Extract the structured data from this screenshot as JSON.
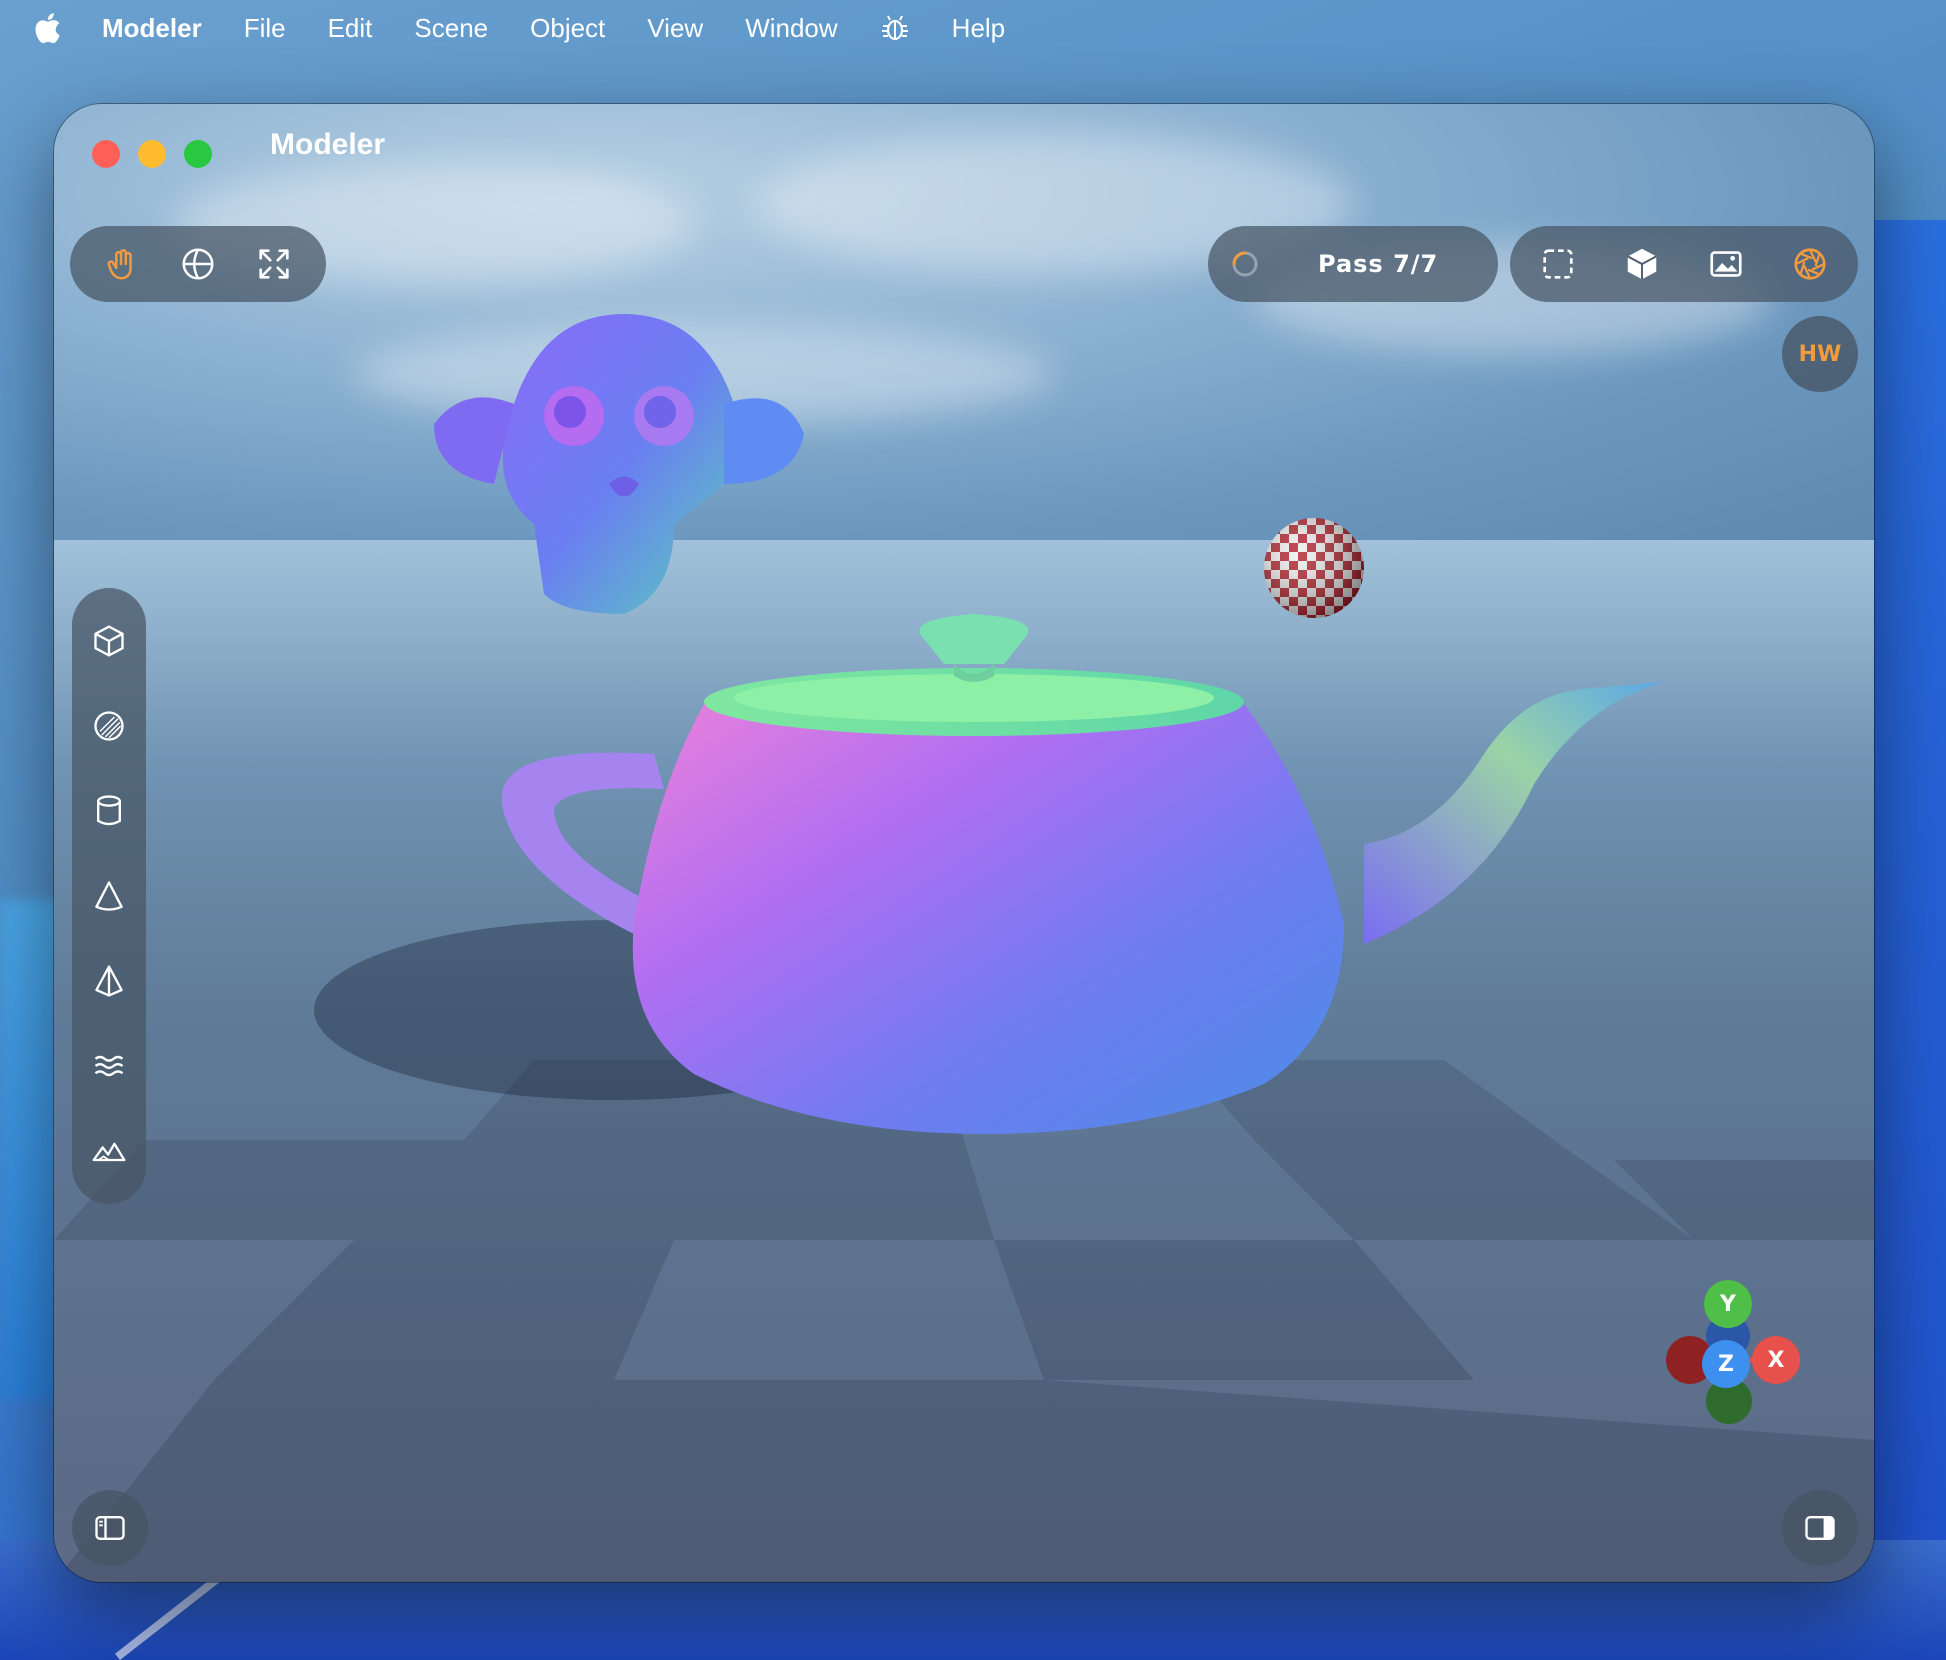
{
  "menubar": {
    "app_name": "Modeler",
    "items": [
      "File",
      "Edit",
      "Scene",
      "Object",
      "View",
      "Window",
      "Help"
    ]
  },
  "window": {
    "title": "Modeler"
  },
  "toolbar_left": {
    "icons": [
      "hand-pan-icon",
      "globe-orbit-icon",
      "fit-view-icon"
    ],
    "active_color": "#f19a3e"
  },
  "render_status": {
    "pass_label": "Pass 7/7"
  },
  "toolbar_right": {
    "icons": [
      "select-region-icon",
      "cube-view-icon",
      "image-icon",
      "render-aperture-icon"
    ],
    "active_color": "#f19a3e"
  },
  "hw_badge": {
    "label": "HW"
  },
  "primitives_bar": {
    "icons": [
      "cube-icon",
      "sphere-icon",
      "cylinder-icon",
      "cone-icon",
      "pyramid-icon",
      "water-icon",
      "terrain-icon"
    ]
  },
  "axis_gizmo": {
    "x_label": "X",
    "y_label": "Y",
    "z_label": "Z",
    "x_color": "#e8504b",
    "y_color": "#4fbf48",
    "z_color": "#3d8ff0"
  },
  "panel_toggles": {
    "left": "sidebar-left-icon",
    "right": "sidebar-right-icon"
  },
  "scene_objects": [
    "monkey-head",
    "teapot",
    "checker-sphere",
    "checker-floor",
    "sky"
  ]
}
